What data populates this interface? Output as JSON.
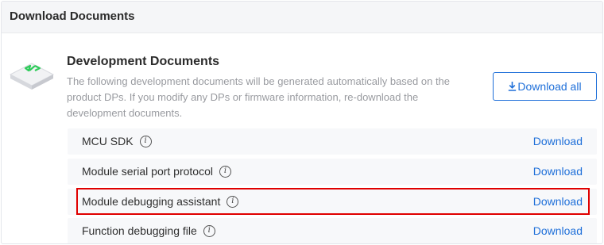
{
  "header": {
    "title": "Download Documents"
  },
  "section": {
    "title": "Development Documents",
    "description": "The following development documents will be generated automatically based on the product DPs. If you modify any DPs or firmware information, re-download the development documents.",
    "icon": "chip-document-icon",
    "download_all_label": "Download all"
  },
  "documents": [
    {
      "label": "MCU SDK",
      "action": "Download"
    },
    {
      "label": "Module serial port protocol",
      "action": "Download"
    },
    {
      "label": "Module debugging assistant",
      "action": "Download",
      "highlighted": true
    },
    {
      "label": "Function debugging file",
      "action": "Download"
    }
  ],
  "colors": {
    "accent": "#1e6fd9",
    "highlight_border": "#e00000",
    "icon_green": "#2ecc5a"
  }
}
